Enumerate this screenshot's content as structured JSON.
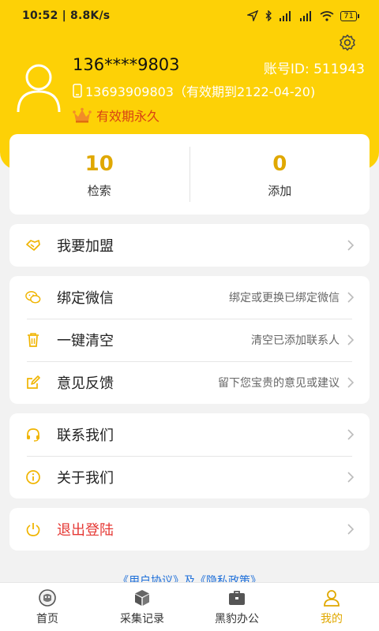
{
  "status_bar": {
    "time": "10:52 | 8.8K/s",
    "battery": "71"
  },
  "profile": {
    "masked_phone": "136****9803",
    "account_id": "账号ID: 511943",
    "bound_phone": "13693909803（有效期到2122-04-20)",
    "validity": "有效期永久"
  },
  "stats": [
    {
      "value": "10",
      "label": "检索"
    },
    {
      "value": "0",
      "label": "添加"
    }
  ],
  "menu": {
    "join": {
      "title": "我要加盟"
    },
    "wechat": {
      "title": "绑定微信",
      "hint": "绑定或更换已绑定微信"
    },
    "clear": {
      "title": "一键清空",
      "hint": "清空已添加联系人"
    },
    "feedback": {
      "title": "意见反馈",
      "hint": "留下您宝贵的意见或建议"
    },
    "contact": {
      "title": "联系我们"
    },
    "about": {
      "title": "关于我们"
    },
    "logout": {
      "title": "退出登陆"
    }
  },
  "agreement": "《用户协议》及《隐私政策》",
  "tabs": [
    {
      "label": "首页",
      "icon": "home-icon"
    },
    {
      "label": "采集记录",
      "icon": "box-icon"
    },
    {
      "label": "黑豹办公",
      "icon": "briefcase-icon"
    },
    {
      "label": "我的",
      "icon": "user-icon"
    }
  ],
  "colors": {
    "brand_yellow": "#fdd106",
    "accent": "#e0a800",
    "logout_red": "#e53935",
    "link_blue": "#1e6fd9"
  }
}
